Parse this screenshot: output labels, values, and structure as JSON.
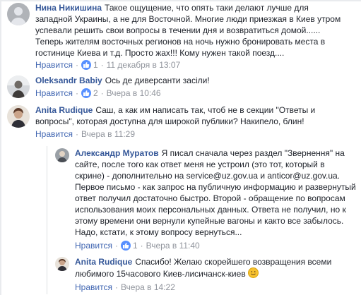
{
  "comments": [
    {
      "author": "Нина Никишина",
      "text": "Такое ощущение, что опять таки делают лучше для\nзападной Украины, а не для Восточной. Многие люди приезжая в Киев утром\nуспевали решить свои вопросы в течении дня и возвратиться домой......\nТеперь жителям восточных регионов на ночь нужно бронировать места в\nгостинице Киева и т.д. Просто жах!!! Кому нужен такой поезд....",
      "like_label": "Нравится",
      "likes": "1",
      "time": "11 декабря в 13:07"
    },
    {
      "author": "Oleksandr Babiy",
      "text": "Ось де диверсанти засіли!",
      "like_label": "Нравится",
      "likes": "2",
      "time": "Вчера в 10:46"
    },
    {
      "author": "Anita Rudique",
      "text": "Саш, а как им написать так, чтоб не в секции \"Ответы и\nвопросы\", которая доступна для широкой публики? Накипело, блин!",
      "like_label": "Нравится",
      "likes": "",
      "time": "Вчера в 11:29"
    },
    {
      "author": "Александр Муратов",
      "text": "Я писал сначала через раздел \"Звернення\" на\nсайте, после того как ответ меня не устроил (это тот, который в\nскрине) - дополнительно на service@uz.gov.ua и anticor@uz.gov.ua.\nПервое письмо - как запрос на публичную информацию и развернутый\nответ получил достаточно быстро. Второй - обращение по вопросам\nиспользования моих персональных данных. Ответа не получил, но к\nэтому времени они вернули купейные вагоны и както все забылось.\nНадо, кстати, к этому вопросу вернуться...",
      "like_label": "Нравится",
      "likes": "1",
      "time": "Вчера в 11:40"
    },
    {
      "author": "Anita Rudique",
      "text": "Спасибо! Желаю скорейшего возвращения всеми\nлюбимого 15часового Киев-лисичанск-киев",
      "like_label": "Нравится",
      "likes": "",
      "time": "Вчера в 14:22"
    }
  ],
  "colors": {
    "author": "#365899",
    "like_link": "#4267b2",
    "meta": "#90949c",
    "like_badge": "#5890ff"
  }
}
